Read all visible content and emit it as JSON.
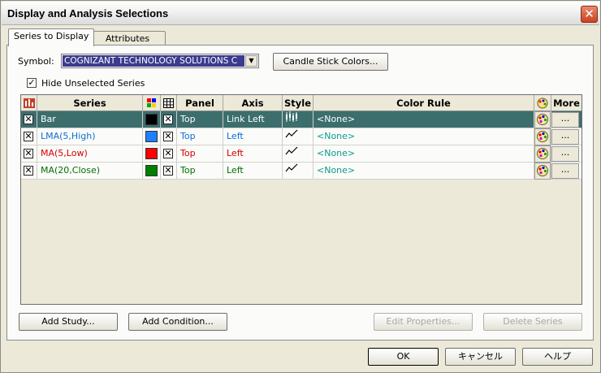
{
  "window": {
    "title": "Display and Analysis Selections"
  },
  "tabs": [
    {
      "label": "Series to Display",
      "active": true
    },
    {
      "label": "Attributes",
      "active": false
    }
  ],
  "symbol": {
    "label": "Symbol:",
    "value": "COGNIZANT TECHNOLOGY SOLUTIONS C"
  },
  "candle_button": "Candle Stick Colors...",
  "hide_unselected": {
    "label": "Hide Unselected Series",
    "checked": true
  },
  "grid": {
    "headers": {
      "series": "Series",
      "panel": "Panel",
      "axis": "Axis",
      "style": "Style",
      "color_rule": "Color Rule",
      "more": "More"
    },
    "rows": [
      {
        "series": "Bar",
        "panel": "Top",
        "axis": "Link Left",
        "rule": "<None>",
        "more": "...",
        "color": "#000000",
        "text_color": "#ffffff",
        "selected": true,
        "style_icon": "candlestick-icon"
      },
      {
        "series": "LMA(5,High)",
        "panel": "Top",
        "axis": "Left",
        "rule": "<None>",
        "more": "...",
        "color": "#1e7fff",
        "text_color": "#0b6fd4",
        "selected": false,
        "style_icon": "line-icon"
      },
      {
        "series": "MA(5,Low)",
        "panel": "Top",
        "axis": "Left",
        "rule": "<None>",
        "more": "...",
        "color": "#ff0000",
        "text_color": "#d40000",
        "selected": false,
        "style_icon": "line-icon"
      },
      {
        "series": "MA(20,Close)",
        "panel": "Top",
        "axis": "Left",
        "rule": "<None>",
        "more": "...",
        "color": "#008000",
        "text_color": "#007000",
        "selected": false,
        "style_icon": "line-icon"
      }
    ]
  },
  "buttons": {
    "add_study": "Add Study...",
    "add_condition": "Add Condition...",
    "edit_properties": "Edit Properties...",
    "delete_series": "Delete Series",
    "ok": "OK",
    "cancel": "キャンセル",
    "help": "ヘルプ"
  }
}
